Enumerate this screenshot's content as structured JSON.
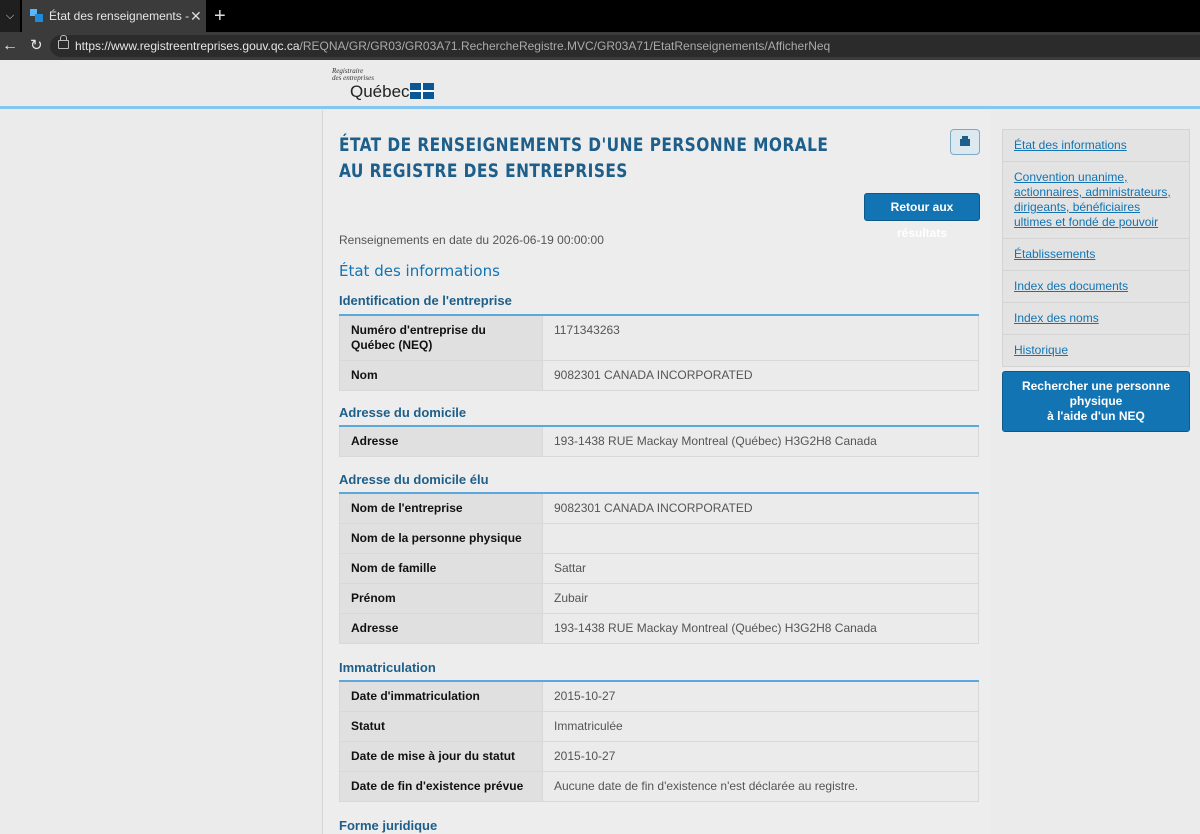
{
  "browser": {
    "tab_title": "État des renseignements - Revenu Québec",
    "url_host": "https://www.registreentreprises.gouv.qc.ca",
    "url_path": "/REQNA/GR/GR03/GR03A71.RechercheRegistre.MVC/GR03A71/EtatRenseignements/AfficherNeq"
  },
  "logo": {
    "line1": "Registraire",
    "line2": "des entreprises",
    "name": "Québec"
  },
  "page": {
    "title": "ÉTAT DE RENSEIGNEMENTS D'UNE PERSONNE MORALE AU REGISTRE DES ENTREPRISES",
    "retour_label": "Retour aux résultats",
    "date_line": "Renseignements en date du 2026-06-19 00:00:00",
    "section_title": "État des informations"
  },
  "groups": {
    "identification": {
      "title": "Identification de l'entreprise",
      "rows": [
        {
          "key": "Numéro d'entreprise du Québec (NEQ)",
          "value": "1171343263"
        },
        {
          "key": "Nom",
          "value": "9082301 CANADA INCORPORATED"
        }
      ]
    },
    "domicile": {
      "title": "Adresse du domicile",
      "rows": [
        {
          "key": "Adresse",
          "value": "193-1438 RUE Mackay Montreal (Québec) H3G2H8 Canada"
        }
      ]
    },
    "domicile_elu": {
      "title": "Adresse du domicile élu",
      "rows": [
        {
          "key": "Nom de l'entreprise",
          "value": "9082301 CANADA INCORPORATED"
        },
        {
          "key": "Nom de la personne physique",
          "value": ""
        },
        {
          "key": "Nom de famille",
          "value": "Sattar"
        },
        {
          "key": "Prénom",
          "value": "Zubair"
        },
        {
          "key": "Adresse",
          "value": "193-1438 RUE Mackay Montreal (Québec) H3G2H8 Canada"
        }
      ]
    },
    "immatriculation": {
      "title": "Immatriculation",
      "rows": [
        {
          "key": "Date d'immatriculation",
          "value": "2015-10-27"
        },
        {
          "key": "Statut",
          "value": "Immatriculée"
        },
        {
          "key": "Date de mise à jour du statut",
          "value": "2015-10-27"
        },
        {
          "key": "Date de fin d'existence prévue",
          "value": "Aucune date de fin d'existence n'est déclarée au registre."
        }
      ]
    },
    "forme": {
      "title": "Forme juridique"
    }
  },
  "sidebar": {
    "items": [
      {
        "label": "État des informations"
      },
      {
        "label": "Convention unanime, actionnaires, administrateurs, dirigeants, bénéficiaires ultimes et fondé de pouvoir"
      },
      {
        "label": "Établissements"
      },
      {
        "label": "Index des documents"
      },
      {
        "label": "Index des noms"
      },
      {
        "label": "Historique"
      }
    ],
    "neq_button_line1": "Rechercher une personne physique",
    "neq_button_line2": "à l'aide d'un NEQ"
  },
  "colors": {
    "accent": "#1274b3",
    "heading": "#1d5f8a",
    "header_rule": "#85c6f0"
  }
}
